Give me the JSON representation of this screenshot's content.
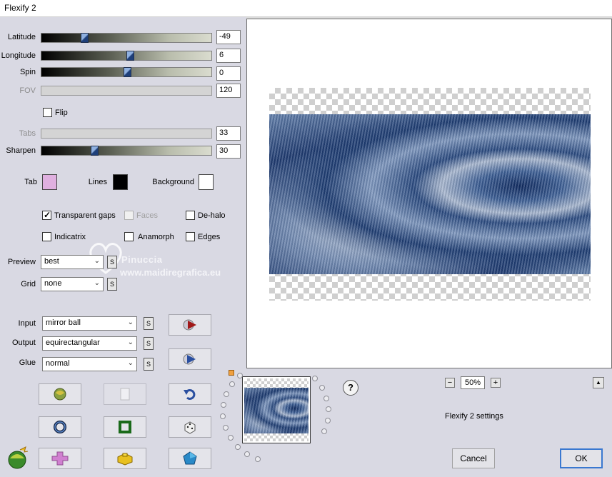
{
  "window": {
    "title": "Flexify 2"
  },
  "sliders": [
    {
      "label": "Latitude",
      "value": "-49",
      "fraction": 0.24,
      "enabled": true
    },
    {
      "label": "Longitude",
      "value": "6",
      "fraction": 0.52,
      "enabled": true
    },
    {
      "label": "Spin",
      "value": "0",
      "fraction": 0.5,
      "enabled": true
    },
    {
      "label": "FOV",
      "value": "120",
      "enabled": false
    }
  ],
  "flip": {
    "label": "Flip",
    "checked": false
  },
  "tabs": {
    "label": "Tabs",
    "value": "33",
    "enabled": false
  },
  "sharpen": {
    "label": "Sharpen",
    "value": "30",
    "fraction": 0.3
  },
  "colors": {
    "tab_label": "Tab",
    "tab_color": "#e0b0e0",
    "lines_label": "Lines",
    "lines_color": "#000000",
    "background_label": "Background",
    "background_color": "#ffffff"
  },
  "options": {
    "transparent_gaps": "Transparent gaps",
    "faces": "Faces",
    "de_halo": "De-halo",
    "indicatrix": "Indicatrix",
    "anamorph": "Anamorph",
    "edges": "Edges"
  },
  "preview": {
    "label": "Preview",
    "value": "best"
  },
  "grid": {
    "label": "Grid",
    "value": "none"
  },
  "input": {
    "label": "Input",
    "value": "mirror ball"
  },
  "output": {
    "label": "Output",
    "value": "equirectangular"
  },
  "glue": {
    "label": "Glue",
    "value": "normal"
  },
  "s_button": "S",
  "watermark": {
    "line1": "Pinuccia",
    "line2": "www.maidiregrafica.eu"
  },
  "zoom": {
    "value": "50%",
    "minus": "−",
    "plus": "+"
  },
  "scroll_up": "▲",
  "help": "?",
  "settings_label": "Flexify 2 settings",
  "buttons": {
    "cancel": "Cancel",
    "ok": "OK"
  },
  "accent": "#1e3f7a"
}
